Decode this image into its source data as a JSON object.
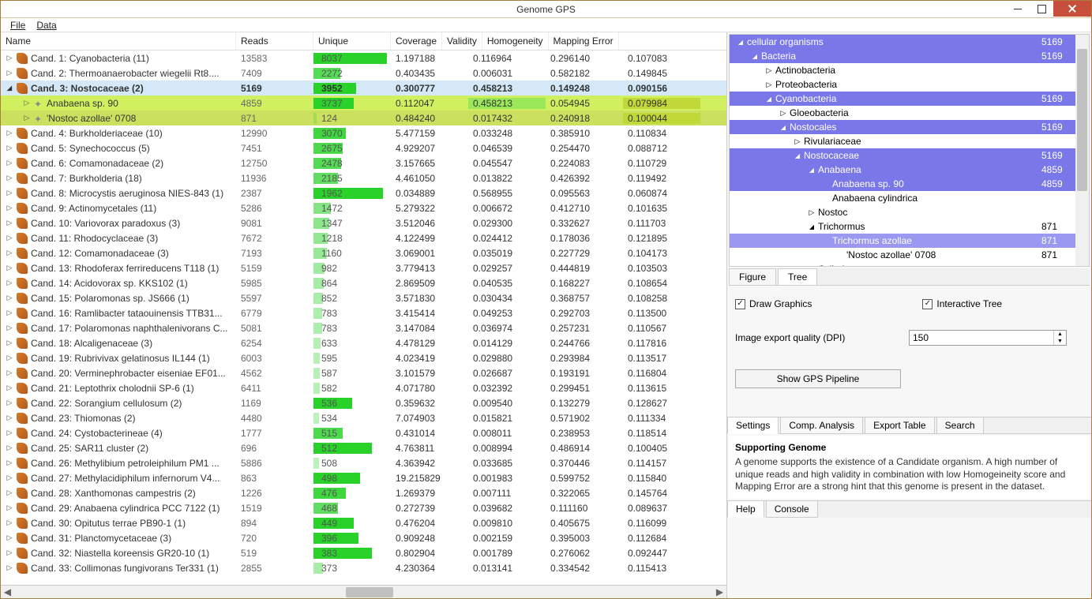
{
  "window": {
    "title": "Genome GPS"
  },
  "menu": [
    "File",
    "Data"
  ],
  "columns": [
    "Name",
    "Reads",
    "Unique",
    "Coverage",
    "Validity",
    "Homogeneity",
    "Mapping Error"
  ],
  "rows": [
    {
      "name": "Cand. 1: Cyanobacteria (11)",
      "reads": "13583",
      "unique": "8037",
      "ubar": 95,
      "cov": "1.197188",
      "val": "0.116964",
      "hom": "0.296140",
      "map": "0.107083"
    },
    {
      "name": "Cand. 2: Thermoanaerobacter wiegelii Rt8....",
      "reads": "7409",
      "unique": "2272",
      "ubar": 35,
      "cov": "0.403435",
      "val": "0.006031",
      "hom": "0.582182",
      "map": "0.149845"
    },
    {
      "name": "Cand. 3: Nostocaceae (2)",
      "reads": "5169",
      "unique": "3952",
      "ubar": 55,
      "cov": "0.300777",
      "val": "0.458213",
      "hom": "0.149248",
      "map": "0.090156",
      "sel": true,
      "open": true
    },
    {
      "name": "Anabaena sp. 90",
      "reads": "4859",
      "unique": "3737",
      "ubar": 52,
      "cov": "0.112047",
      "val": "0.458213",
      "hom": "0.054945",
      "map": "0.079984",
      "child": 1
    },
    {
      "name": "'Nostoc azollae' 0708",
      "reads": "871",
      "unique": "124",
      "ubar": 4,
      "cov": "0.484240",
      "val": "0.017432",
      "hom": "0.240918",
      "map": "0.100044",
      "child": 2
    },
    {
      "name": "Cand. 4: Burkholderiaceae (10)",
      "reads": "12990",
      "unique": "3070",
      "ubar": 42,
      "cov": "5.477159",
      "val": "0.033248",
      "hom": "0.385910",
      "map": "0.110834"
    },
    {
      "name": "Cand. 5: Synechococcus (5)",
      "reads": "7451",
      "unique": "2675",
      "ubar": 38,
      "cov": "4.929207",
      "val": "0.046539",
      "hom": "0.254470",
      "map": "0.088712"
    },
    {
      "name": "Cand. 6: Comamonadaceae (2)",
      "reads": "12750",
      "unique": "2478",
      "ubar": 36,
      "cov": "3.157665",
      "val": "0.045547",
      "hom": "0.224083",
      "map": "0.110729"
    },
    {
      "name": "Cand. 7: Burkholderia (18)",
      "reads": "11936",
      "unique": "2185",
      "ubar": 32,
      "cov": "4.461050",
      "val": "0.013822",
      "hom": "0.426392",
      "map": "0.119492"
    },
    {
      "name": "Cand. 8: Microcystis aeruginosa NIES-843 (1)",
      "reads": "2387",
      "unique": "1962",
      "ubar": 90,
      "cov": "0.034889",
      "val": "0.568955",
      "hom": "0.095563",
      "map": "0.060874"
    },
    {
      "name": "Cand. 9: Actinomycetales (11)",
      "reads": "5286",
      "unique": "1472",
      "ubar": 22,
      "cov": "5.279322",
      "val": "0.006672",
      "hom": "0.412710",
      "map": "0.101635"
    },
    {
      "name": "Cand. 10: Variovorax paradoxus (3)",
      "reads": "9081",
      "unique": "1347",
      "ubar": 20,
      "cov": "3.512046",
      "val": "0.029300",
      "hom": "0.332627",
      "map": "0.111703"
    },
    {
      "name": "Cand. 11: Rhodocyclaceae (3)",
      "reads": "7672",
      "unique": "1218",
      "ubar": 18,
      "cov": "4.122499",
      "val": "0.024412",
      "hom": "0.178036",
      "map": "0.121895"
    },
    {
      "name": "Cand. 12: Comamonadaceae (3)",
      "reads": "7193",
      "unique": "1160",
      "ubar": 17,
      "cov": "3.069001",
      "val": "0.035019",
      "hom": "0.227729",
      "map": "0.104173"
    },
    {
      "name": "Cand. 13: Rhodoferax ferrireducens T118 (1)",
      "reads": "5159",
      "unique": "982",
      "ubar": 14,
      "cov": "3.779413",
      "val": "0.029257",
      "hom": "0.444819",
      "map": "0.103503"
    },
    {
      "name": "Cand. 14: Acidovorax sp. KKS102 (1)",
      "reads": "5985",
      "unique": "864",
      "ubar": 13,
      "cov": "2.869509",
      "val": "0.040535",
      "hom": "0.168227",
      "map": "0.108654"
    },
    {
      "name": "Cand. 15: Polaromonas sp. JS666 (1)",
      "reads": "5597",
      "unique": "852",
      "ubar": 12,
      "cov": "3.571830",
      "val": "0.030434",
      "hom": "0.368757",
      "map": "0.108258"
    },
    {
      "name": "Cand. 16: Ramlibacter tataouinensis TTB31...",
      "reads": "6779",
      "unique": "783",
      "ubar": 11,
      "cov": "3.415414",
      "val": "0.049253",
      "hom": "0.292703",
      "map": "0.113500"
    },
    {
      "name": "Cand. 17: Polaromonas naphthalenivorans C...",
      "reads": "5081",
      "unique": "783",
      "ubar": 11,
      "cov": "3.147084",
      "val": "0.036974",
      "hom": "0.257231",
      "map": "0.110567"
    },
    {
      "name": "Cand. 18: Alcaligenaceae (3)",
      "reads": "6254",
      "unique": "633",
      "ubar": 9,
      "cov": "4.478129",
      "val": "0.014129",
      "hom": "0.244766",
      "map": "0.117816"
    },
    {
      "name": "Cand. 19: Rubrivivax gelatinosus IL144 (1)",
      "reads": "6003",
      "unique": "595",
      "ubar": 8,
      "cov": "4.023419",
      "val": "0.029880",
      "hom": "0.293984",
      "map": "0.113517"
    },
    {
      "name": "Cand. 20: Verminephrobacter eiseniae EF01...",
      "reads": "4562",
      "unique": "587",
      "ubar": 8,
      "cov": "3.101579",
      "val": "0.026687",
      "hom": "0.193191",
      "map": "0.116804"
    },
    {
      "name": "Cand. 21: Leptothrix cholodnii SP-6 (1)",
      "reads": "6411",
      "unique": "582",
      "ubar": 8,
      "cov": "4.071780",
      "val": "0.032392",
      "hom": "0.299451",
      "map": "0.113615"
    },
    {
      "name": "Cand. 22: Sorangium cellulosum (2)",
      "reads": "1169",
      "unique": "536",
      "ubar": 50,
      "cov": "0.359632",
      "val": "0.009540",
      "hom": "0.132279",
      "map": "0.128627"
    },
    {
      "name": "Cand. 23: Thiomonas (2)",
      "reads": "4480",
      "unique": "534",
      "ubar": 7,
      "cov": "7.074903",
      "val": "0.015821",
      "hom": "0.571902",
      "map": "0.111334"
    },
    {
      "name": "Cand. 24: Cystobacterineae (4)",
      "reads": "1777",
      "unique": "515",
      "ubar": 38,
      "cov": "0.431014",
      "val": "0.008011",
      "hom": "0.238953",
      "map": "0.118514"
    },
    {
      "name": "Cand. 25: SAR11 cluster (2)",
      "reads": "696",
      "unique": "512",
      "ubar": 75,
      "cov": "4.763811",
      "val": "0.008994",
      "hom": "0.486914",
      "map": "0.100405"
    },
    {
      "name": "Cand. 26: Methylibium petroleiphilum PM1 ...",
      "reads": "5886",
      "unique": "508",
      "ubar": 7,
      "cov": "4.363942",
      "val": "0.033685",
      "hom": "0.370446",
      "map": "0.114157"
    },
    {
      "name": "Cand. 27: Methylacidiphilum infernorum V4...",
      "reads": "863",
      "unique": "498",
      "ubar": 60,
      "cov": "19.215829",
      "val": "0.001983",
      "hom": "0.599752",
      "map": "0.115840"
    },
    {
      "name": "Cand. 28: Xanthomonas campestris (2)",
      "reads": "1226",
      "unique": "476",
      "ubar": 42,
      "cov": "1.269379",
      "val": "0.007111",
      "hom": "0.322065",
      "map": "0.145764"
    },
    {
      "name": "Cand. 29: Anabaena cylindrica PCC 7122 (1)",
      "reads": "1519",
      "unique": "468",
      "ubar": 32,
      "cov": "0.272739",
      "val": "0.039682",
      "hom": "0.111160",
      "map": "0.089637"
    },
    {
      "name": "Cand. 30: Opitutus terrae PB90-1 (1)",
      "reads": "894",
      "unique": "449",
      "ubar": 52,
      "cov": "0.476204",
      "val": "0.009810",
      "hom": "0.405675",
      "map": "0.116099"
    },
    {
      "name": "Cand. 31: Planctomycetaceae (3)",
      "reads": "720",
      "unique": "396",
      "ubar": 58,
      "cov": "0.909248",
      "val": "0.002159",
      "hom": "0.395003",
      "map": "0.112684"
    },
    {
      "name": "Cand. 32: Niastella koreensis GR20-10 (1)",
      "reads": "519",
      "unique": "383",
      "ubar": 75,
      "cov": "0.802904",
      "val": "0.001789",
      "hom": "0.276062",
      "map": "0.092447"
    },
    {
      "name": "Cand. 33: Collimonas fungivorans Ter331 (1)",
      "reads": "2855",
      "unique": "373",
      "ubar": 12,
      "cov": "4.230364",
      "val": "0.013141",
      "hom": "0.334542",
      "map": "0.115413"
    }
  ],
  "tree": [
    {
      "label": "cellular organisms",
      "count": "5169",
      "indent": 0,
      "open": true,
      "hl": true
    },
    {
      "label": "Bacteria",
      "count": "5169",
      "indent": 1,
      "open": true,
      "hl": true
    },
    {
      "label": "Actinobacteria",
      "count": "",
      "indent": 2,
      "open": false
    },
    {
      "label": "Proteobacteria",
      "count": "",
      "indent": 2,
      "open": false
    },
    {
      "label": "Cyanobacteria",
      "count": "5169",
      "indent": 2,
      "open": true,
      "hl": true
    },
    {
      "label": "Gloeobacteria",
      "count": "",
      "indent": 3,
      "open": false
    },
    {
      "label": "Nostocales",
      "count": "5169",
      "indent": 3,
      "open": true,
      "hl": true
    },
    {
      "label": "Rivulariaceae",
      "count": "",
      "indent": 4,
      "open": false
    },
    {
      "label": "Nostocaceae",
      "count": "5169",
      "indent": 4,
      "open": true,
      "hl": true
    },
    {
      "label": "Anabaena",
      "count": "4859",
      "indent": 5,
      "open": true,
      "hl": true
    },
    {
      "label": "Anabaena sp. 90",
      "count": "4859",
      "indent": 6,
      "hl": true
    },
    {
      "label": "Anabaena cylindrica",
      "count": "",
      "indent": 6
    },
    {
      "label": "Nostoc",
      "count": "",
      "indent": 5,
      "open": false
    },
    {
      "label": "Trichormus",
      "count": "871",
      "indent": 5,
      "open": true
    },
    {
      "label": "Trichormus azollae",
      "count": "871",
      "indent": 6,
      "hl": "hl2"
    },
    {
      "label": "'Nostoc azollae' 0708",
      "count": "871",
      "indent": 7
    },
    {
      "label": "Cylindrospermum",
      "count": "",
      "indent": 5,
      "open": false
    }
  ],
  "right_tabs": [
    "Figure",
    "Tree"
  ],
  "right_tabs_active": 1,
  "checks": {
    "draw_graphics": "Draw Graphics",
    "interactive_tree": "Interactive Tree"
  },
  "dpi": {
    "label": "Image export quality (DPI)",
    "value": "150"
  },
  "pipeline_btn": "Show GPS Pipeline",
  "sub_tabs": [
    "Settings",
    "Comp. Analysis",
    "Export Table",
    "Search"
  ],
  "sub_tabs_active": 0,
  "info": {
    "title": "Supporting Genome",
    "body": "A genome supports the existence of a Candidate organism. A high number of unique reads and high validity in combination with low Homogeineity score and Mapping Error are a strong hint that this genome is present in the dataset."
  },
  "bottom_tabs": [
    "Help",
    "Console"
  ]
}
